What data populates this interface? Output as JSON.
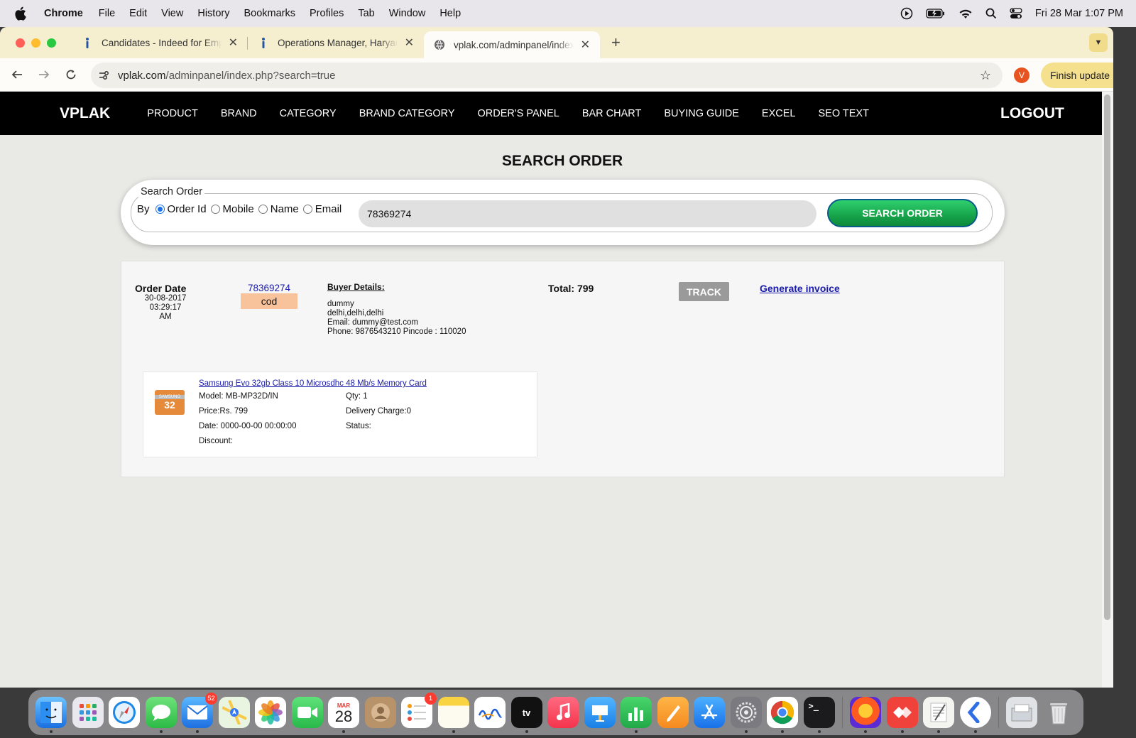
{
  "menubar": {
    "app_name": "Chrome",
    "items": [
      "File",
      "Edit",
      "View",
      "History",
      "Bookmarks",
      "Profiles",
      "Tab",
      "Window",
      "Help"
    ],
    "datetime": "Fri 28 Mar  1:07 PM"
  },
  "browser": {
    "tabs": [
      {
        "title": "Candidates - Indeed for Employers"
      },
      {
        "title": "Operations Manager, Haryana"
      },
      {
        "title": "vplak.com/adminpanel/index.php"
      }
    ],
    "url_host": "vplak.com",
    "url_path": "/adminpanel/index.php?search=true",
    "profile_initial": "V",
    "finish_update_label": "Finish update"
  },
  "site": {
    "brand": "VPLAK",
    "nav": [
      "PRODUCT",
      "BRAND",
      "CATEGORY",
      "BRAND CATEGORY",
      "ORDER'S PANEL",
      "BAR CHART",
      "BUYING GUIDE",
      "EXCEL",
      "SEO TEXT"
    ],
    "logout": "LOGOUT"
  },
  "search": {
    "title": "SEARCH ORDER",
    "legend": "Search Order",
    "by_label": "By",
    "options": [
      {
        "label": "Order Id",
        "checked": true
      },
      {
        "label": "Mobile",
        "checked": false
      },
      {
        "label": "Name",
        "checked": false
      },
      {
        "label": "Email",
        "checked": false
      }
    ],
    "query": "78369274",
    "button_label": "SEARCH ORDER"
  },
  "order": {
    "date_label": "Order Date",
    "date": "30-08-2017",
    "time": "03:29:17 AM",
    "order_id": "78369274",
    "payment": "cod",
    "buyer_heading": "Buyer Details:",
    "buyer_name": "dummy",
    "buyer_address": "delhi,delhi,delhi",
    "buyer_email": "Email: dummy@test.com",
    "buyer_phone": "Phone: 9876543210 Pincode : 110020",
    "total": "Total: 799",
    "track_label": "TRACK",
    "invoice_label": "Generate invoice",
    "item": {
      "thumb_brand": "SAMSUNG",
      "thumb_size": "32",
      "name": "Samsung Evo 32gb Class 10 Microsdhc 48 Mb/s Memory Card",
      "model": "Model: MB-MP32D/IN",
      "qty": "Qty: 1",
      "price": "Price:Rs. 799",
      "delivery": "Delivery Charge:0",
      "date": "Date: 0000-00-00 00:00:00",
      "status": "Status:",
      "discount": "Discount:"
    }
  },
  "dock": {
    "badges": {
      "mail": "52",
      "calendar_month": "MAR",
      "calendar_day": "28",
      "reminders": "1"
    }
  }
}
